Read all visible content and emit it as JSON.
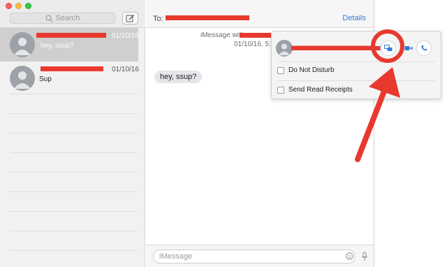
{
  "sidebar": {
    "search_placeholder": "Search",
    "conversations": [
      {
        "date": "01/10/16",
        "preview": "hey, ssup?",
        "selected": true
      },
      {
        "date": "01/10/16",
        "preview": "Sup",
        "selected": false
      }
    ]
  },
  "header": {
    "to_label": "To:",
    "details_label": "Details"
  },
  "thread": {
    "service_label": "iMessage with",
    "timestamp": "01/10/16, 5:3",
    "messages": [
      {
        "text": "hey, ssup?"
      }
    ]
  },
  "composer": {
    "placeholder": "iMessage"
  },
  "details_popover": {
    "options": [
      {
        "label": "Do Not Disturb",
        "checked": false
      },
      {
        "label": "Send Read Receipts",
        "checked": false
      }
    ]
  },
  "colors": {
    "accent": "#2e7bdc",
    "redaction": "#e8392e",
    "annotation": "#e8392e"
  }
}
